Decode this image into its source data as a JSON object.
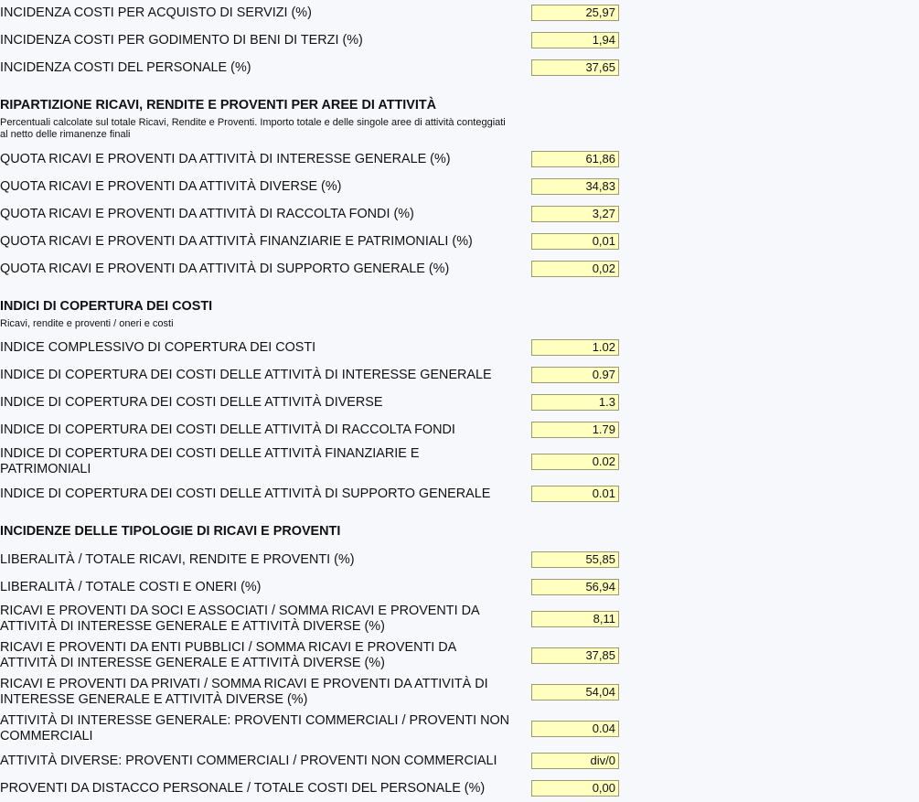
{
  "top": [
    {
      "label": "INCIDENZA COSTI PER ACQUISTO DI SERVIZI (%)",
      "value": "25,97"
    },
    {
      "label": "INCIDENZA COSTI PER GODIMENTO DI BENI DI TERZI (%)",
      "value": "1,94"
    },
    {
      "label": "INCIDENZA COSTI DEL PERSONALE (%)",
      "value": "37,65"
    }
  ],
  "ripartizione": {
    "title": "RIPARTIZIONE RICAVI, RENDITE E PROVENTI PER AREE DI ATTIVITÀ",
    "desc": "Percentuali calcolate sul totale Ricavi, Rendite e Proventi. Importo totale e delle singole aree di attività conteggiati al netto delle rimanenze finali",
    "rows": [
      {
        "label": "QUOTA RICAVI E PROVENTI DA ATTIVITÀ DI INTERESSE GENERALE (%)",
        "value": "61,86"
      },
      {
        "label": "QUOTA RICAVI E PROVENTI DA ATTIVITÀ DIVERSE (%)",
        "value": "34,83"
      },
      {
        "label": "QUOTA RICAVI E PROVENTI DA ATTIVITÀ DI RACCOLTA FONDI (%)",
        "value": "3,27"
      },
      {
        "label": "QUOTA RICAVI E PROVENTI DA ATTIVITÀ FINANZIARIE E PATRIMONIALI (%)",
        "value": "0,01"
      },
      {
        "label": "QUOTA RICAVI E PROVENTI DA ATTIVITÀ DI SUPPORTO GENERALE (%)",
        "value": "0,02"
      }
    ]
  },
  "copertura": {
    "title": "INDICI DI COPERTURA DEI COSTI",
    "desc": "Ricavi, rendite e proventi / oneri e costi",
    "rows": [
      {
        "label": "INDICE COMPLESSIVO DI COPERTURA DEI COSTI",
        "value": "1.02"
      },
      {
        "label": "INDICE DI COPERTURA DEI COSTI DELLE ATTIVITÀ DI INTERESSE GENERALE",
        "value": "0.97"
      },
      {
        "label": "INDICE DI COPERTURA DEI COSTI DELLE ATTIVITÀ DIVERSE",
        "value": "1.3"
      },
      {
        "label": "INDICE DI COPERTURA DEI COSTI DELLE ATTIVITÀ DI RACCOLTA FONDI",
        "value": "1.79"
      },
      {
        "label": "INDICE DI COPERTURA DEI COSTI DELLE ATTIVITÀ FINANZIARIE E PATRIMONIALI",
        "value": "0.02"
      },
      {
        "label": "INDICE DI COPERTURA DEI COSTI DELLE ATTIVITÀ DI SUPPORTO GENERALE",
        "value": "0.01"
      }
    ]
  },
  "incidenze": {
    "title": "INCIDENZE DELLE TIPOLOGIE DI RICAVI E PROVENTI",
    "rows": [
      {
        "label": "LIBERALITÀ / TOTALE RICAVI, RENDITE E PROVENTI (%)",
        "value": "55,85"
      },
      {
        "label": "LIBERALITÀ / TOTALE COSTI E ONERI (%)",
        "value": "56,94"
      },
      {
        "label": "RICAVI E PROVENTI DA SOCI E ASSOCIATI / SOMMA RICAVI E PROVENTI DA ATTIVITÀ DI INTERESSE GENERALE E ATTIVITÀ DIVERSE (%)",
        "value": "8,11"
      },
      {
        "label": "RICAVI E PROVENTI DA ENTI PUBBLICI / SOMMA RICAVI E PROVENTI DA ATTIVITÀ DI INTERESSE GENERALE E ATTIVITÀ DIVERSE (%)",
        "value": "37,85"
      },
      {
        "label": "RICAVI E PROVENTI DA PRIVATI / SOMMA RICAVI E PROVENTI DA ATTIVITÀ DI INTERESSE GENERALE E ATTIVITÀ DIVERSE (%)",
        "value": "54,04"
      },
      {
        "label": "ATTIVITÀ DI INTERESSE GENERALE: PROVENTI COMMERCIALI / PROVENTI NON COMMERCIALI",
        "value": "0.04"
      },
      {
        "label": "ATTIVITÀ DIVERSE: PROVENTI COMMERCIALI / PROVENTI NON COMMERCIALI",
        "value": "div/0"
      },
      {
        "label": "PROVENTI DA DISTACCO PERSONALE / TOTALE COSTI DEL PERSONALE (%)",
        "value": "0,00"
      }
    ]
  }
}
